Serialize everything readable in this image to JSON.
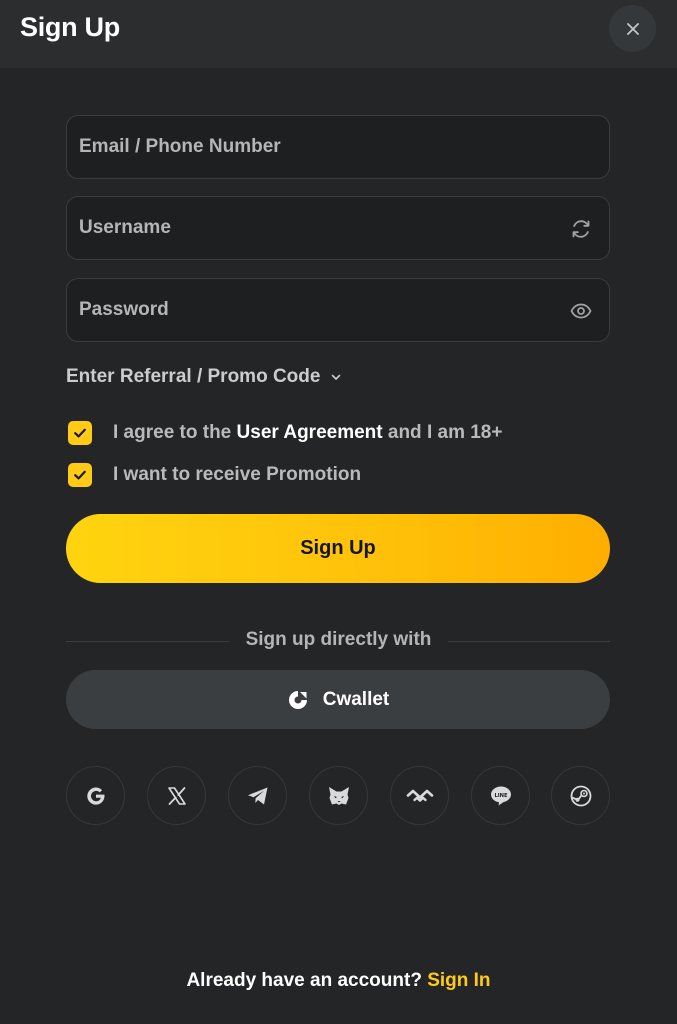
{
  "header": {
    "title": "Sign Up",
    "close_icon": "close-icon"
  },
  "form": {
    "email": {
      "placeholder": "Email / Phone Number",
      "value": ""
    },
    "username": {
      "placeholder": "Username",
      "value": "",
      "icon": "refresh-icon"
    },
    "password": {
      "placeholder": "Password",
      "value": "",
      "icon": "eye-icon"
    },
    "promo_label": "Enter Referral / Promo Code",
    "promo_icon": "chevron-down-icon"
  },
  "agreements": {
    "terms_prefix": "I agree to the ",
    "terms_link": "User Agreement",
    "terms_suffix": " and I am 18+",
    "terms_checked": true,
    "promotion_label": "I want to receive Promotion",
    "promotion_checked": true
  },
  "signup_button": "Sign Up",
  "divider_text": "Sign up directly with",
  "cwallet": {
    "label": "Cwallet",
    "icon": "cwallet-icon"
  },
  "social_icons": [
    "google-icon",
    "x-icon",
    "telegram-icon",
    "metamask-icon",
    "walletconnect-icon",
    "line-icon",
    "steam-icon"
  ],
  "footer": {
    "prompt": "Already have an account? ",
    "link": "Sign In"
  },
  "colors": {
    "background": "#242526",
    "header": "#2b2d2e",
    "accent": "#ffcb16",
    "field_bg": "#1e1f20",
    "muted_text": "#b2b6b9"
  }
}
